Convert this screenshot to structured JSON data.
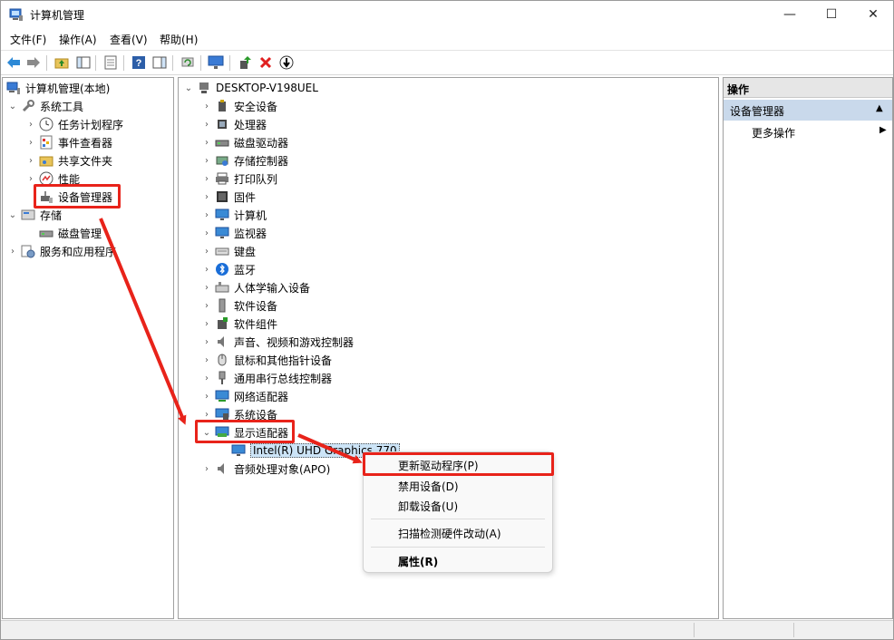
{
  "window": {
    "title": "计算机管理",
    "minimize": "—",
    "maximize": "☐",
    "close": "✕"
  },
  "menu": {
    "file": "文件(F)",
    "action": "操作(A)",
    "view": "查看(V)",
    "help": "帮助(H)"
  },
  "toolbar": [
    "back-icon",
    "forward-icon",
    "up-folder-icon",
    "show-tree-icon",
    "properties-icon",
    "help-icon",
    "show-action-pane-icon",
    "refresh-icon",
    "monitor-icon",
    "update-driver-icon",
    "uninstall-icon",
    "download-icon"
  ],
  "left_tree": {
    "root": "计算机管理(本地)",
    "system_tools": "系统工具",
    "task_scheduler": "任务计划程序",
    "event_viewer": "事件查看器",
    "shared_folders": "共享文件夹",
    "performance": "性能",
    "device_manager": "设备管理器",
    "storage": "存储",
    "disk_management": "磁盘管理",
    "services_apps": "服务和应用程序"
  },
  "device_tree": {
    "computer": "DESKTOP-V198UEL",
    "categories": [
      {
        "label": "安全设备",
        "icon": "security-device-icon"
      },
      {
        "label": "处理器",
        "icon": "processor-icon"
      },
      {
        "label": "磁盘驱动器",
        "icon": "disk-drive-icon"
      },
      {
        "label": "存储控制器",
        "icon": "storage-controller-icon"
      },
      {
        "label": "打印队列",
        "icon": "printer-icon"
      },
      {
        "label": "固件",
        "icon": "firmware-icon"
      },
      {
        "label": "计算机",
        "icon": "computer-icon"
      },
      {
        "label": "监视器",
        "icon": "monitor-icon"
      },
      {
        "label": "键盘",
        "icon": "keyboard-icon"
      },
      {
        "label": "蓝牙",
        "icon": "bluetooth-icon"
      },
      {
        "label": "人体学输入设备",
        "icon": "hid-icon"
      },
      {
        "label": "软件设备",
        "icon": "software-device-icon"
      },
      {
        "label": "软件组件",
        "icon": "software-component-icon"
      },
      {
        "label": "声音、视频和游戏控制器",
        "icon": "speaker-icon"
      },
      {
        "label": "鼠标和其他指针设备",
        "icon": "mouse-icon"
      },
      {
        "label": "通用串行总线控制器",
        "icon": "usb-icon"
      },
      {
        "label": "网络适配器",
        "icon": "network-adapter-icon"
      },
      {
        "label": "系统设备",
        "icon": "system-device-icon"
      },
      {
        "label": "显示适配器",
        "icon": "display-adapter-icon"
      },
      {
        "label": "音频处理对象(APO)",
        "icon": "audio-processing-icon"
      }
    ],
    "display_child": "Intel(R) UHD Graphics 770"
  },
  "actions_pane": {
    "header": "操作",
    "section": "设备管理器",
    "more": "更多操作"
  },
  "context_menu": {
    "update_driver": "更新驱动程序(P)",
    "disable": "禁用设备(D)",
    "uninstall": "卸载设备(U)",
    "scan": "扫描检测硬件改动(A)",
    "properties": "属性(R)"
  },
  "colors": {
    "annotation_red": "#e8231a",
    "selection_bg": "#cce4f7",
    "actions_header_bg": "#e6e6e6",
    "actions_section_bg": "#c9d9eb"
  }
}
